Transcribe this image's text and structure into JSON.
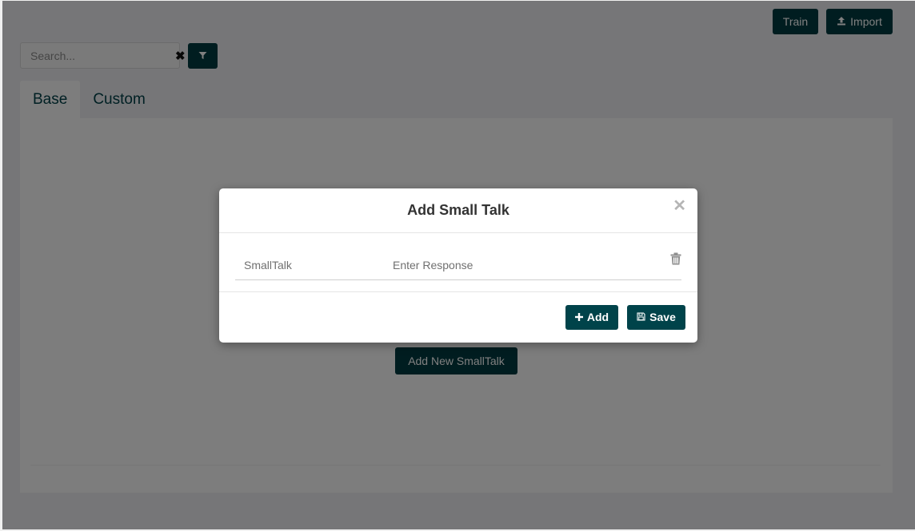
{
  "header": {
    "train_label": "Train",
    "import_label": "Import",
    "import_icon": "upload-icon"
  },
  "search": {
    "placeholder": "Search...",
    "value": "",
    "clear_icon": "close-icon",
    "filter_icon": "filter-icon"
  },
  "tabs": [
    {
      "label": "Base",
      "active": true
    },
    {
      "label": "Custom",
      "active": false
    }
  ],
  "main": {
    "add_new_label": "Add New SmallTalk"
  },
  "modal": {
    "title": "Add Small Talk",
    "close_icon": "close-icon",
    "rows": [
      {
        "smalltalk_placeholder": "SmallTalk",
        "smalltalk_value": "",
        "response_placeholder": "Enter Response",
        "response_value": "",
        "delete_icon": "trash-icon"
      }
    ],
    "add_label": "Add",
    "add_icon": "plus-icon",
    "save_label": "Save",
    "save_icon": "save-icon"
  },
  "colors": {
    "primary": "#00434a",
    "backdrop": "rgba(0,0,0,0.5)"
  }
}
